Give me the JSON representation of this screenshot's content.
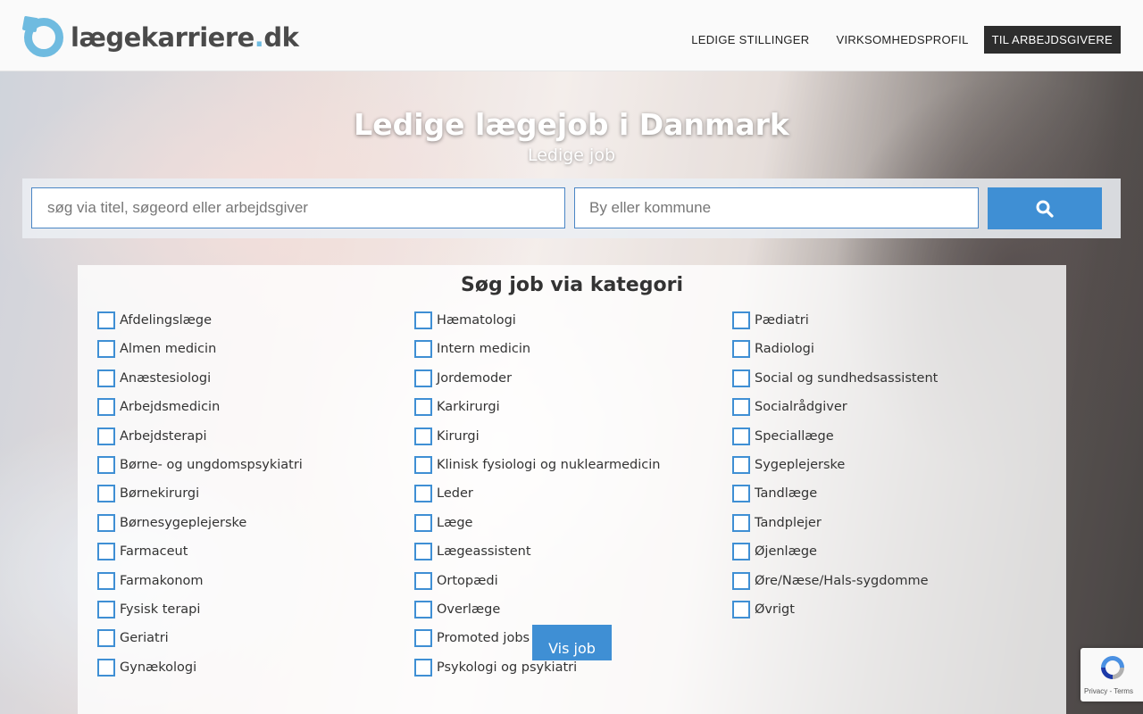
{
  "header": {
    "logo_main": "lægekarriere",
    "logo_dot": ".",
    "logo_tld": "dk",
    "nav": [
      {
        "label": "LEDIGE STILLINGER"
      },
      {
        "label": "VIRKSOMHEDSPROFIL"
      }
    ],
    "employer_button": "TIL ARBEJDSGIVERE"
  },
  "hero": {
    "title": "Ledige lægejob i Danmark",
    "subtitle": "Ledige job"
  },
  "search": {
    "query_placeholder": "søg via titel, søgeord eller arbejdsgiver",
    "location_placeholder": "By eller kommune",
    "query_value": "",
    "location_value": "",
    "search_icon": "search-icon"
  },
  "categories": {
    "title": "Søg job via kategori",
    "columns": [
      [
        {
          "label": "Afdelingslæge",
          "checked": false
        },
        {
          "label": "Almen medicin",
          "checked": false
        },
        {
          "label": "Anæstesiologi",
          "checked": false
        },
        {
          "label": "Arbejdsmedicin",
          "checked": false
        },
        {
          "label": "Arbejdsterapi",
          "checked": false
        },
        {
          "label": "Børne- og ungdomspsykiatri",
          "checked": false
        },
        {
          "label": "Børnekirurgi",
          "checked": false
        },
        {
          "label": "Børnesygeplejerske",
          "checked": false
        },
        {
          "label": "Farmaceut",
          "checked": false
        },
        {
          "label": "Farmakonom",
          "checked": false
        },
        {
          "label": "Fysisk terapi",
          "checked": false
        },
        {
          "label": "Geriatri",
          "checked": false
        },
        {
          "label": "Gynækologi",
          "checked": false
        }
      ],
      [
        {
          "label": "Hæmatologi",
          "checked": false
        },
        {
          "label": "Intern medicin",
          "checked": false
        },
        {
          "label": "Jordemoder",
          "checked": false
        },
        {
          "label": "Karkirurgi",
          "checked": false
        },
        {
          "label": "Kirurgi",
          "checked": false
        },
        {
          "label": "Klinisk fysiologi og nuklearmedicin",
          "checked": false
        },
        {
          "label": "Leder",
          "checked": false
        },
        {
          "label": "Læge",
          "checked": false
        },
        {
          "label": "Lægeassistent",
          "checked": false
        },
        {
          "label": "Ortopædi",
          "checked": false
        },
        {
          "label": "Overlæge",
          "checked": false
        },
        {
          "label": "Promoted jobs",
          "checked": false
        },
        {
          "label": "Psykologi og psykiatri",
          "checked": false
        }
      ],
      [
        {
          "label": "Pædiatri",
          "checked": false
        },
        {
          "label": "Radiologi",
          "checked": false
        },
        {
          "label": "Social og sundhedsassistent",
          "checked": false
        },
        {
          "label": "Socialrådgiver",
          "checked": false
        },
        {
          "label": "Speciallæge",
          "checked": false
        },
        {
          "label": "Sygeplejerske",
          "checked": false
        },
        {
          "label": "Tandlæge",
          "checked": false
        },
        {
          "label": "Tandplejer",
          "checked": false
        },
        {
          "label": "Øjenlæge",
          "checked": false
        },
        {
          "label": "Øre/Næse/Hals-sygdomme",
          "checked": false
        },
        {
          "label": "Øvrigt",
          "checked": false
        }
      ]
    ],
    "submit_label": "Vis job"
  },
  "recaptcha": {
    "links": "Privacy - Terms"
  },
  "colors": {
    "accent": "#3f8fd4",
    "logo": "#6fbbe0",
    "dark_button": "#2d2d2d"
  }
}
